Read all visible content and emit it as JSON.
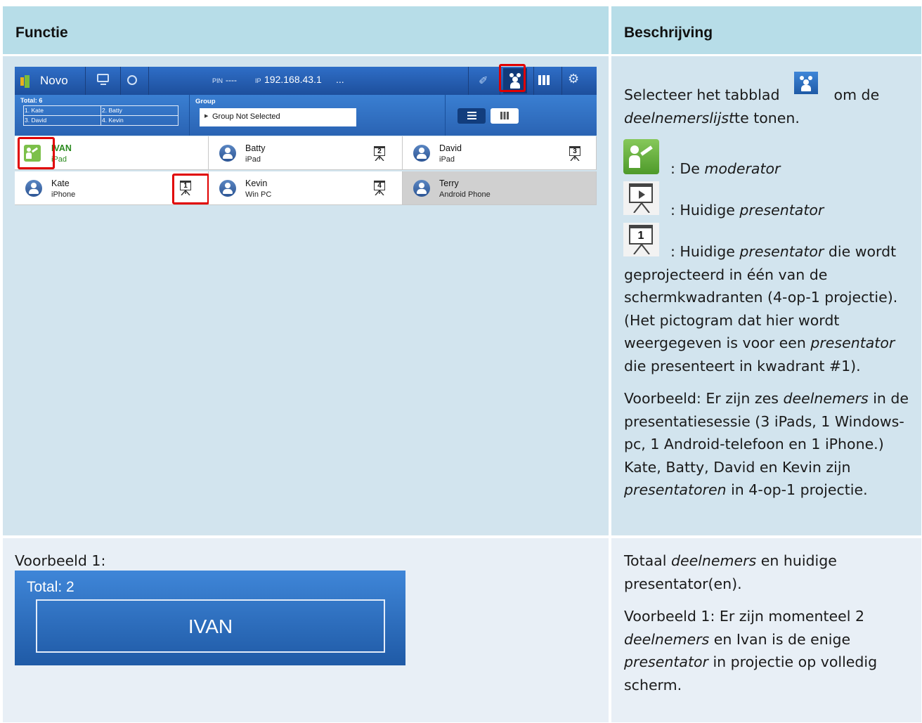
{
  "table": {
    "col1_header": "Functie",
    "col2_header": "Beschrijving"
  },
  "app": {
    "name": "Novo",
    "pin_label": "PIN",
    "pin_value": "----",
    "ip_label": "IP",
    "ip_value": "192.168.43.1",
    "ip_more": "...",
    "total_label": "Total: 6",
    "presenters": [
      "1. Kate",
      "2. Batty",
      "3. David",
      "4. Kevin"
    ],
    "group_label": "Group",
    "group_value": "Group Not Selected",
    "participants": [
      {
        "name": "IVAN",
        "device": "iPad",
        "role": "moderator"
      },
      {
        "name": "Batty",
        "device": "iPad",
        "quadrant": "2"
      },
      {
        "name": "David",
        "device": "iPad",
        "quadrant": "3"
      },
      {
        "name": "Kate",
        "device": "iPhone",
        "quadrant": "1"
      },
      {
        "name": "Kevin",
        "device": "Win PC",
        "quadrant": "4"
      },
      {
        "name": "Terry",
        "device": "Android Phone"
      }
    ]
  },
  "desc1": {
    "select_pre": "Selecteer het tabblad",
    "select_post": "om de",
    "list_em": "deelnemerslijst",
    "list_post": "te tonen.",
    "moderator_pre": ": De ",
    "moderator_em": "moderator",
    "presenter_pre": ": Huidige ",
    "presenter_em": "presentator",
    "quad_pre": ": Huidige ",
    "quad_em": "presentator",
    "quad_post": " die wordt geprojecteerd in één van de schermkwadranten (4-op-1 projectie). (Het pictogram dat hier wordt weergegeven is voor een ",
    "quad_em2": "presentator",
    "quad_post2": " die presenteert in kwadrant #1).",
    "example_pre": "Voorbeeld: Er zijn zes ",
    "example_em": "deelnemers",
    "example_mid": " in de presentatiesessie (3 iPads, 1 Windows-pc, 1 Android-telefoon en 1 iPhone.) Kate, Batty, David en Kevin zijn ",
    "example_em2": "presentatoren",
    "example_post": " in 4-op-1 projectie."
  },
  "example1": {
    "label": "Voorbeeld 1:",
    "total": "Total: 2",
    "presenter": "IVAN"
  },
  "desc2": {
    "p1_pre": "Totaal ",
    "p1_em": "deelnemers",
    "p1_post": " en huidige presentator(en).",
    "p2_pre": "Voorbeeld 1: Er zijn momenteel 2 ",
    "p2_em": "deelnemers",
    "p2_mid": " en Ivan is de enige ",
    "p2_em2": "presentator",
    "p2_post": " in projectie op volledig scherm."
  }
}
